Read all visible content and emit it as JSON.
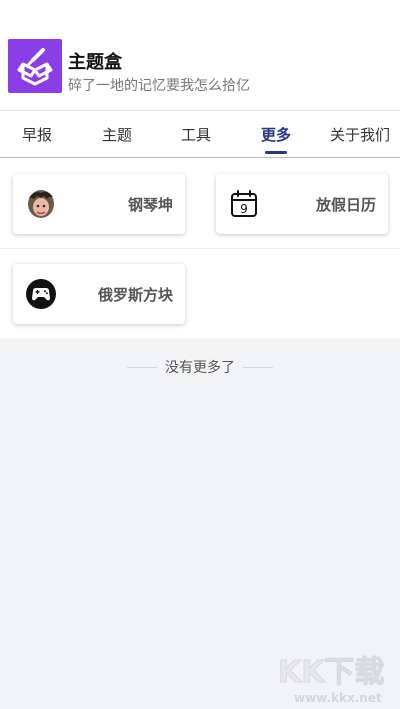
{
  "header": {
    "title": "主题盒",
    "subtitle": "碎了一地的记忆要我怎么拾亿"
  },
  "tabs": [
    {
      "label": "早报",
      "active": false
    },
    {
      "label": "主题",
      "active": false
    },
    {
      "label": "工具",
      "active": false
    },
    {
      "label": "更多",
      "active": true
    },
    {
      "label": "关于我们",
      "active": false
    }
  ],
  "cards": [
    {
      "label": "钢琴坤",
      "icon": "avatar-photo-icon"
    },
    {
      "label": "放假日历",
      "icon": "calendar-icon",
      "icon_text": "9"
    },
    {
      "label": "俄罗斯方块",
      "icon": "gamepad-icon"
    }
  ],
  "end_note": "没有更多了",
  "watermark": {
    "text": "KK下载",
    "url_text": "www.kkx.net"
  },
  "colors": {
    "accent": "#2a3780",
    "app_icon_bg": "#8a3ee6",
    "page_bg": "#f2f3f5"
  }
}
